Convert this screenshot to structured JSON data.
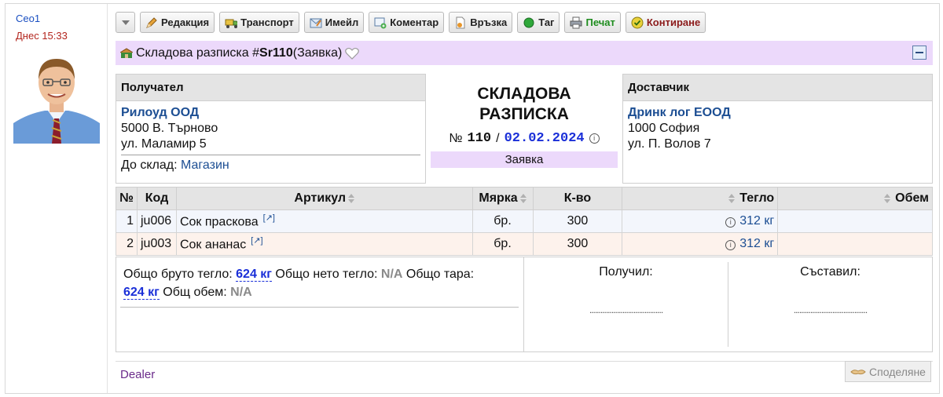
{
  "author": {
    "name": "Ceo1",
    "time": "Днес 15:33"
  },
  "toolbar": {
    "edit": "Редакция",
    "transport": "Транспорт",
    "email": "Имейл",
    "comment": "Коментар",
    "link": "Връзка",
    "tag": "Таг",
    "print": "Печат",
    "contir": "Контиране"
  },
  "title": {
    "prefix": "Складова разписка #",
    "code": "Sr110",
    "suffix": " (Заявка)"
  },
  "recipient": {
    "header": "Получател",
    "name": "Рилоуд ООД",
    "address1": "5000 В. Търново",
    "address2": "ул. Маламир 5",
    "store_label": "До склад: ",
    "store_name": "Магазин"
  },
  "document": {
    "title_line1": "СКЛАДОВА",
    "title_line2": "РАЗПИСКА",
    "number_prefix": "№",
    "number": "110",
    "separator": "/",
    "date": "02.02.2024",
    "status": "Заявка"
  },
  "supplier": {
    "header": "Доставчик",
    "name": "Дринк лог ЕООД",
    "address1": "1000 София",
    "address2": "ул. П. Волов 7"
  },
  "table": {
    "headers": [
      "№",
      "Код",
      "Артикул",
      "Мярка",
      "К-во",
      "Тегло",
      "Обем"
    ],
    "rows": [
      {
        "no": "1",
        "code": "ju006",
        "article": "Сок праскова",
        "unit": "бр.",
        "qty": "300",
        "weight": "312 кг",
        "volume": ""
      },
      {
        "no": "2",
        "code": "ju003",
        "article": "Сок ананас",
        "unit": "бр.",
        "qty": "300",
        "weight": "312 кг",
        "volume": ""
      }
    ]
  },
  "totals": {
    "gross_label": "Общо бруто тегло: ",
    "gross_value": "624 кг",
    "net_label": " Общо нето тегло: ",
    "net_value": "N/A",
    "tare_label": " Общо тара: ",
    "tare_value": "624 кг",
    "volume_label": " Общ обем: ",
    "volume_value": "N/A"
  },
  "signatures": {
    "received": "Получил:",
    "composed": "Съставил:",
    "dots": "........................................"
  },
  "footer": {
    "dealer": "Dealer",
    "share": "Споделяне"
  },
  "colors": {
    "accent_purple": "#ecd9fb",
    "link_blue": "#1c4e93",
    "date_blue": "#1a2fd8"
  }
}
